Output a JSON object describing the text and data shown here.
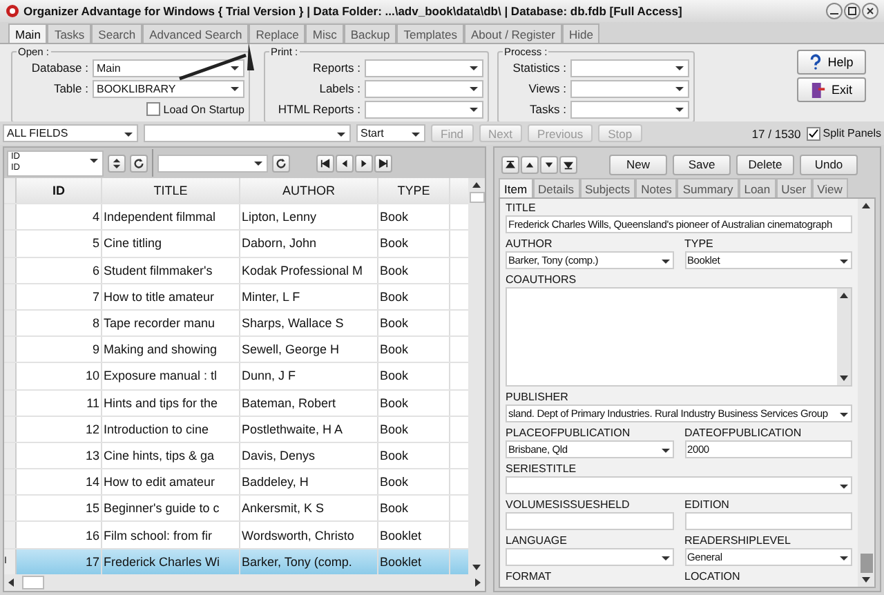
{
  "window": {
    "title": "Organizer Advantage for Windows { Trial Version } | Data Folder: ...\\adv_book\\data\\db\\ | Database: db.fdb [Full Access]"
  },
  "tabs": [
    {
      "label": "Main",
      "selected": true
    },
    {
      "label": "Tasks",
      "selected": false
    },
    {
      "label": "Search",
      "selected": false
    },
    {
      "label": "Advanced Search",
      "selected": false
    },
    {
      "label": "Replace",
      "selected": false
    },
    {
      "label": "Misc",
      "selected": false
    },
    {
      "label": "Backup",
      "selected": false
    },
    {
      "label": "Templates",
      "selected": false
    },
    {
      "label": "About / Register",
      "selected": false
    },
    {
      "label": "Hide",
      "selected": false
    }
  ],
  "open_group": {
    "legend": "Open :",
    "database": {
      "label": "Database :",
      "value": "Main"
    },
    "table": {
      "label": "Table :",
      "value": "BOOKLIBRARY"
    },
    "load_on_startup": {
      "label": "Load On Startup",
      "checked": false
    }
  },
  "print_group": {
    "legend": "Print :",
    "fields": [
      {
        "label": "Reports :"
      },
      {
        "label": "Labels :"
      },
      {
        "label": "HTML Reports :"
      }
    ]
  },
  "process_group": {
    "legend": "Process :",
    "fields": [
      {
        "label": "Statistics :"
      },
      {
        "label": "Views :"
      },
      {
        "label": "Tasks :"
      }
    ]
  },
  "side_buttons": [
    {
      "label": "Help",
      "kind": "help"
    },
    {
      "label": "Exit",
      "kind": "exit"
    }
  ],
  "search_bar": {
    "field": "ALL FIELDS",
    "mode": "Start",
    "buttons": [
      {
        "label": "Find",
        "disabled": true
      },
      {
        "label": "Next",
        "disabled": true
      },
      {
        "label": "Previous",
        "disabled": true
      },
      {
        "label": "Stop",
        "disabled": true
      }
    ],
    "counter": "17 / 1530",
    "split_panels": {
      "label": "Split Panels",
      "checked": true
    }
  },
  "grid_toolbar": {
    "sort_field": "ID",
    "sort_caption": "ID"
  },
  "table": {
    "current_marker": "I",
    "columns": [
      "ID",
      "TITLE",
      "AUTHOR",
      "TYPE"
    ],
    "rows": [
      {
        "id": "4",
        "title": "Independent filmmal",
        "author": "Lipton, Lenny",
        "type": "Book",
        "selected": false
      },
      {
        "id": "5",
        "title": "Cine titling",
        "author": "Daborn, John",
        "type": "Book",
        "selected": false
      },
      {
        "id": "6",
        "title": "Student filmmaker's",
        "author": "Kodak Professional M",
        "type": "Book",
        "selected": false
      },
      {
        "id": "7",
        "title": "How to title amateur",
        "author": "Minter, L F",
        "type": "Book",
        "selected": false
      },
      {
        "id": "8",
        "title": "Tape recorder manu",
        "author": "Sharps, Wallace S",
        "type": "Book",
        "selected": false
      },
      {
        "id": "9",
        "title": "Making and showing",
        "author": "Sewell, George H",
        "type": "Book",
        "selected": false
      },
      {
        "id": "10",
        "title": "Exposure manual : tl",
        "author": "Dunn, J F",
        "type": "Book",
        "selected": false
      },
      {
        "id": "11",
        "title": "Hints and tips for the",
        "author": "Bateman, Robert",
        "type": "Book",
        "selected": false
      },
      {
        "id": "12",
        "title": "Introduction to cine",
        "author": "Postlethwaite, H A",
        "type": "Book",
        "selected": false
      },
      {
        "id": "13",
        "title": "Cine hints, tips & ga",
        "author": "Davis, Denys",
        "type": "Book",
        "selected": false
      },
      {
        "id": "14",
        "title": "How to edit amateur",
        "author": "Baddeley, H",
        "type": "Book",
        "selected": false
      },
      {
        "id": "15",
        "title": "Beginner's guide to c",
        "author": "Ankersmit, K S",
        "type": "Book",
        "selected": false
      },
      {
        "id": "16",
        "title": "Film school: from fir",
        "author": "Wordsworth, Christo",
        "type": "Booklet",
        "selected": false
      },
      {
        "id": "17",
        "title": "Frederick Charles Wi",
        "author": "Barker, Tony (comp.",
        "type": "Booklet",
        "selected": true
      }
    ]
  },
  "record_buttons": [
    {
      "label": "New"
    },
    {
      "label": "Save"
    },
    {
      "label": "Delete"
    },
    {
      "label": "Undo"
    }
  ],
  "detail_tabs": [
    {
      "label": "Item",
      "selected": true
    },
    {
      "label": "Details",
      "selected": false
    },
    {
      "label": "Subjects",
      "selected": false
    },
    {
      "label": "Notes",
      "selected": false
    },
    {
      "label": "Summary",
      "selected": false
    },
    {
      "label": "Loan",
      "selected": false
    },
    {
      "label": "User",
      "selected": false
    },
    {
      "label": "View",
      "selected": false
    }
  ],
  "field_rows": [
    [
      {
        "label": "TITLE",
        "kind": "text",
        "value": "Frederick Charles Wills, Queensland's pioneer of Australian cinematograph"
      }
    ],
    [
      {
        "label": "AUTHOR",
        "kind": "select",
        "value": "Barker, Tony (comp.)"
      },
      {
        "label": "TYPE",
        "kind": "select",
        "value": "Booklet"
      }
    ],
    [
      {
        "label": "COAUTHORS",
        "kind": "memo"
      }
    ],
    [
      {
        "label": "PUBLISHER",
        "kind": "select",
        "value": "sland. Dept of Primary Industries. Rural Industry Business Services Group"
      }
    ],
    [
      {
        "label": "PLACEOFPUBLICATION",
        "kind": "select",
        "value": "Brisbane, Qld"
      },
      {
        "label": "DATEOFPUBLICATION",
        "kind": "text",
        "value": "2000"
      }
    ],
    [
      {
        "label": "SERIESTITLE",
        "kind": "select"
      }
    ],
    [
      {
        "label": "VOLUMESISSUESHELD",
        "kind": "text"
      },
      {
        "label": "EDITION",
        "kind": "text"
      }
    ],
    [
      {
        "label": "LANGUAGE",
        "kind": "select"
      },
      {
        "label": "READERSHIPLEVEL",
        "kind": "select",
        "value": "General"
      }
    ],
    [
      {
        "label": "FORMAT",
        "kind": "label"
      },
      {
        "label": "LOCATION",
        "kind": "label"
      }
    ]
  ]
}
